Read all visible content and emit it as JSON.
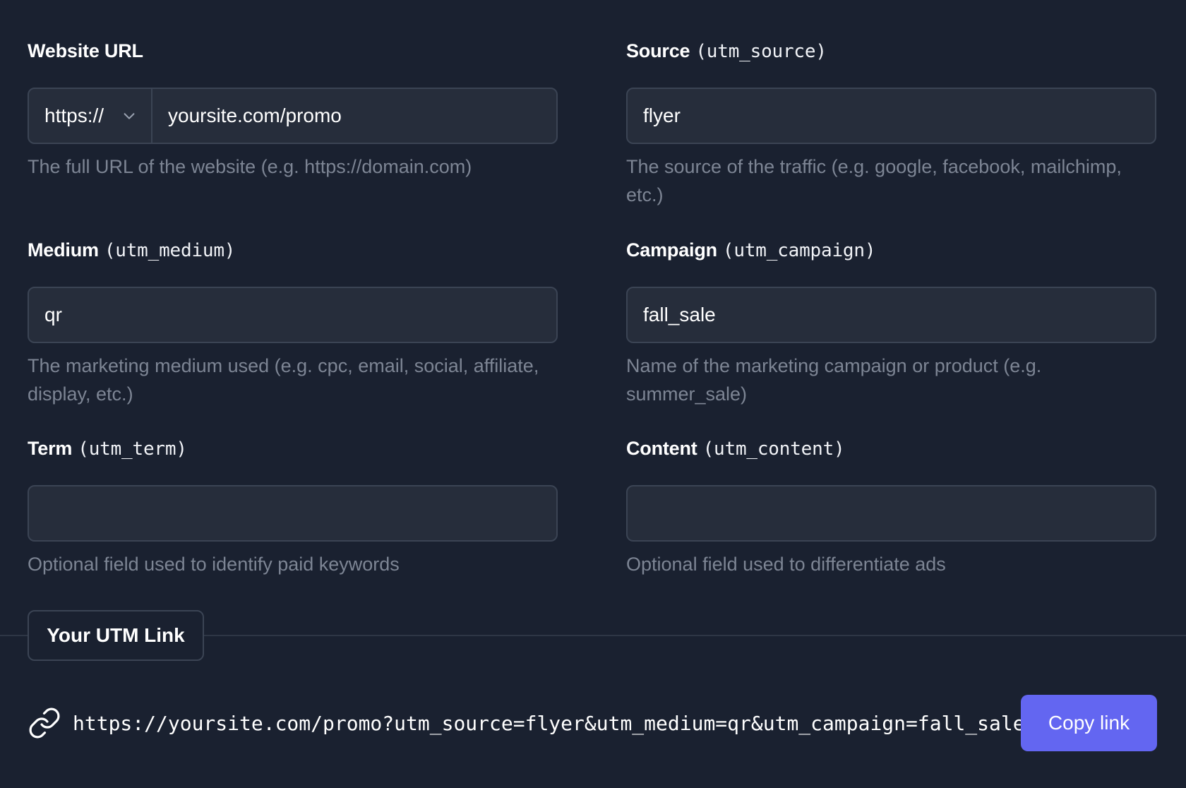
{
  "fields": {
    "website_url": {
      "label": "Website URL",
      "protocol": "https://",
      "value": "yoursite.com/promo",
      "hint": "The full URL of the website (e.g. https://domain.com)"
    },
    "source": {
      "label": "Source",
      "param": "(utm_source)",
      "value": "flyer",
      "hint": "The source of the traffic (e.g. google, facebook, mailchimp, etc.)"
    },
    "medium": {
      "label": "Medium",
      "param": "(utm_medium)",
      "value": "qr",
      "hint": "The marketing medium used (e.g. cpc, email, social, affiliate, display, etc.)"
    },
    "campaign": {
      "label": "Campaign",
      "param": "(utm_campaign)",
      "value": "fall_sale",
      "hint": "Name of the marketing campaign or product (e.g. summer_sale)"
    },
    "term": {
      "label": "Term",
      "param": "(utm_term)",
      "value": "",
      "hint": "Optional field used to identify paid keywords"
    },
    "content": {
      "label": "Content",
      "param": "(utm_content)",
      "value": "",
      "hint": "Optional field used to differentiate ads"
    }
  },
  "result": {
    "tab_label": "Your UTM Link",
    "url": "https://yoursite.com/promo?utm_source=flyer&utm_medium=qr&utm_campaign=fall_sale",
    "copy_label": "Copy link"
  },
  "icons": {
    "chevron": "chevron-down-icon",
    "link": "link-icon"
  }
}
